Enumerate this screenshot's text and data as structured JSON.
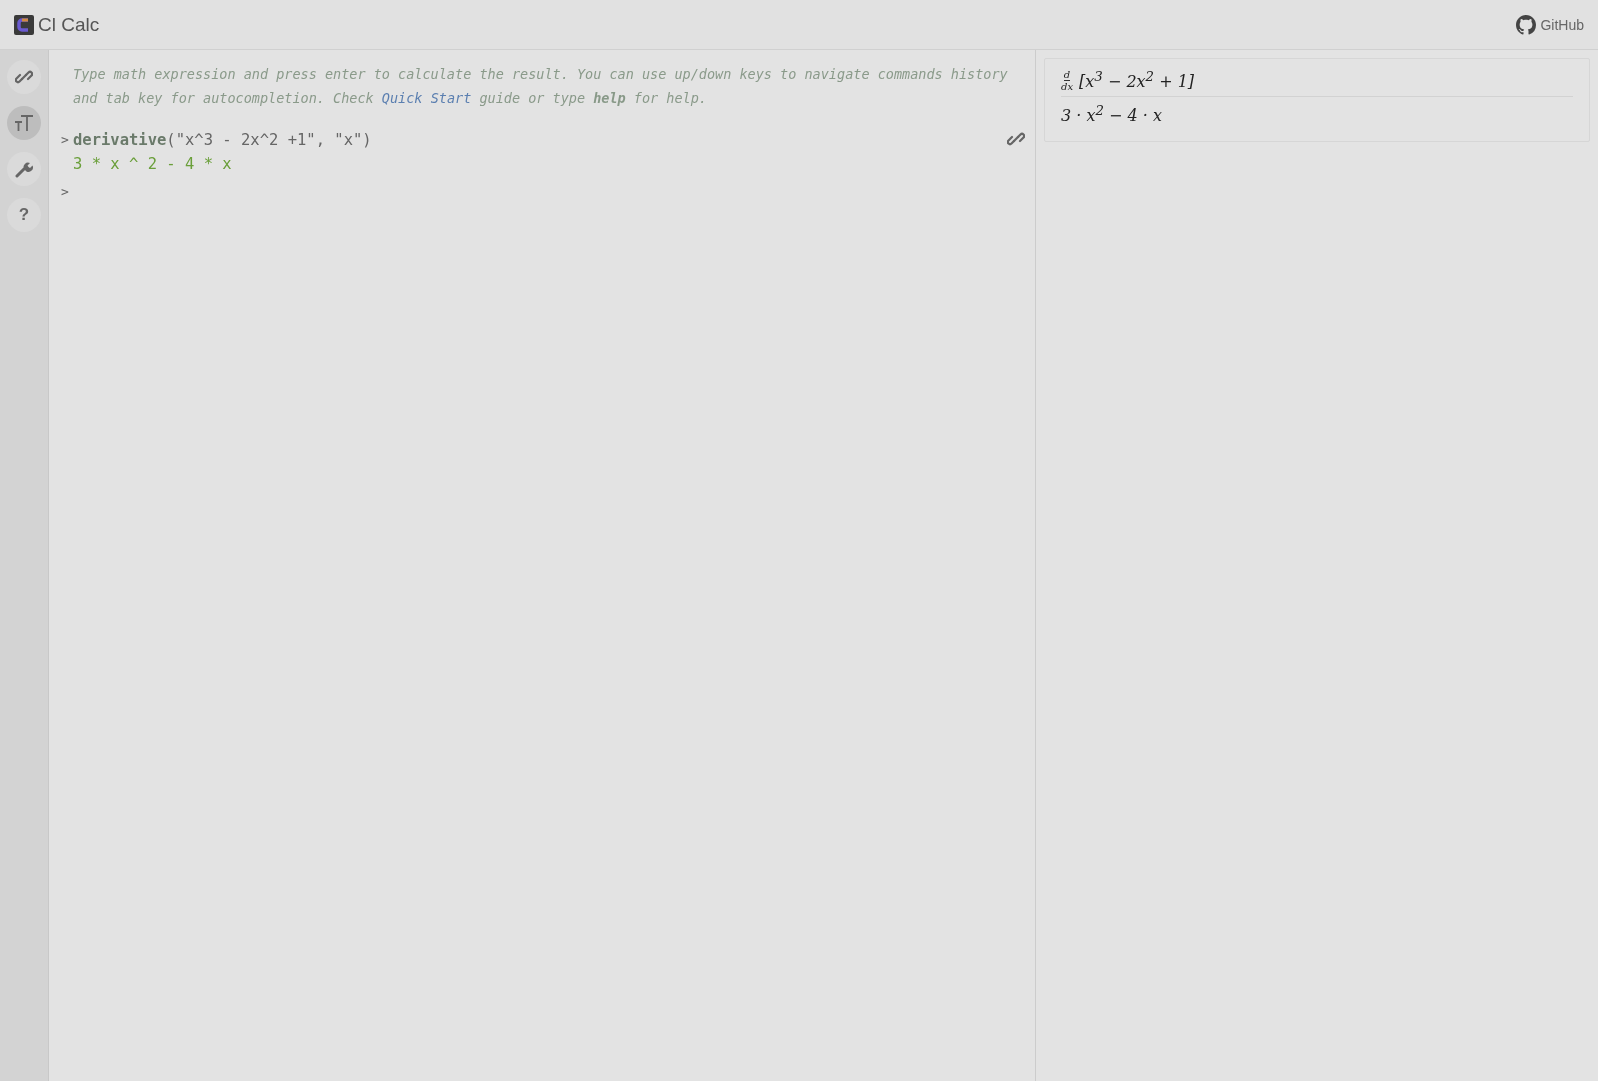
{
  "header": {
    "title": "Cl Calc",
    "github_link": "GitHub"
  },
  "sidebar": {
    "items": [
      {
        "kind": "link",
        "selected": false
      },
      {
        "kind": "text",
        "selected": true
      },
      {
        "kind": "wrench",
        "selected": false
      },
      {
        "kind": "help",
        "label": "?",
        "selected": false
      }
    ]
  },
  "console": {
    "intro_before": "Type math expression and press enter to calculate the result. You can use up/down keys to navigate commands history and tab key for autocompletion. Check ",
    "intro_link": "Quick Start",
    "intro_after": " guide or type **help** for help.",
    "entries": [
      {
        "prompt": ">",
        "function": "derivative",
        "args": "(\"x^3 - 2x^2 +1\", \"x\")",
        "result": "3 * x ^ 2 - 4 * x"
      }
    ],
    "empty_prompt": ">"
  },
  "preview": {
    "numerator": "d",
    "denominator": "dx",
    "expression": "[x$^{3}$ − 2x$^{2}$ + 1]",
    "result": "3 · x$^{2}$ − 4 · x"
  }
}
